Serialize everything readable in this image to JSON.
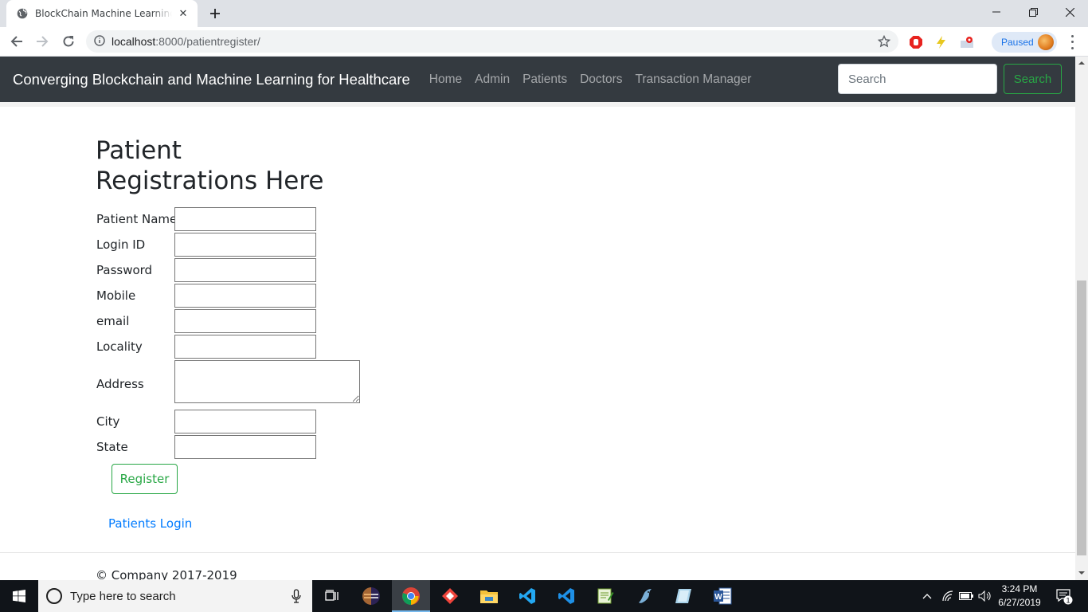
{
  "browser": {
    "tab_title": "BlockChain Machine Learning · Bl",
    "url_host": "localhost",
    "url_path": ":8000/patientregister/",
    "profile_status": "Paused"
  },
  "navbar": {
    "brand": "Converging Blockchain and Machine Learning for Healthcare",
    "links": [
      "Home",
      "Admin",
      "Patients",
      "Doctors",
      "Transaction Manager"
    ],
    "search_placeholder": "Search",
    "search_button": "Search"
  },
  "page": {
    "title": "Patient Registrations Here",
    "fields": {
      "patient_name": "Patient Name",
      "login_id": "Login ID",
      "password": "Password",
      "mobile": "Mobile",
      "email": "email",
      "locality": "Locality",
      "address": "Address",
      "city": "City",
      "state": "State"
    },
    "register_button": "Register",
    "login_link": "Patients Login",
    "footer": "© Company 2017-2019"
  },
  "taskbar": {
    "search_placeholder": "Type here to search",
    "time": "3:24 PM",
    "date": "6/27/2019",
    "notification_count": "1"
  }
}
